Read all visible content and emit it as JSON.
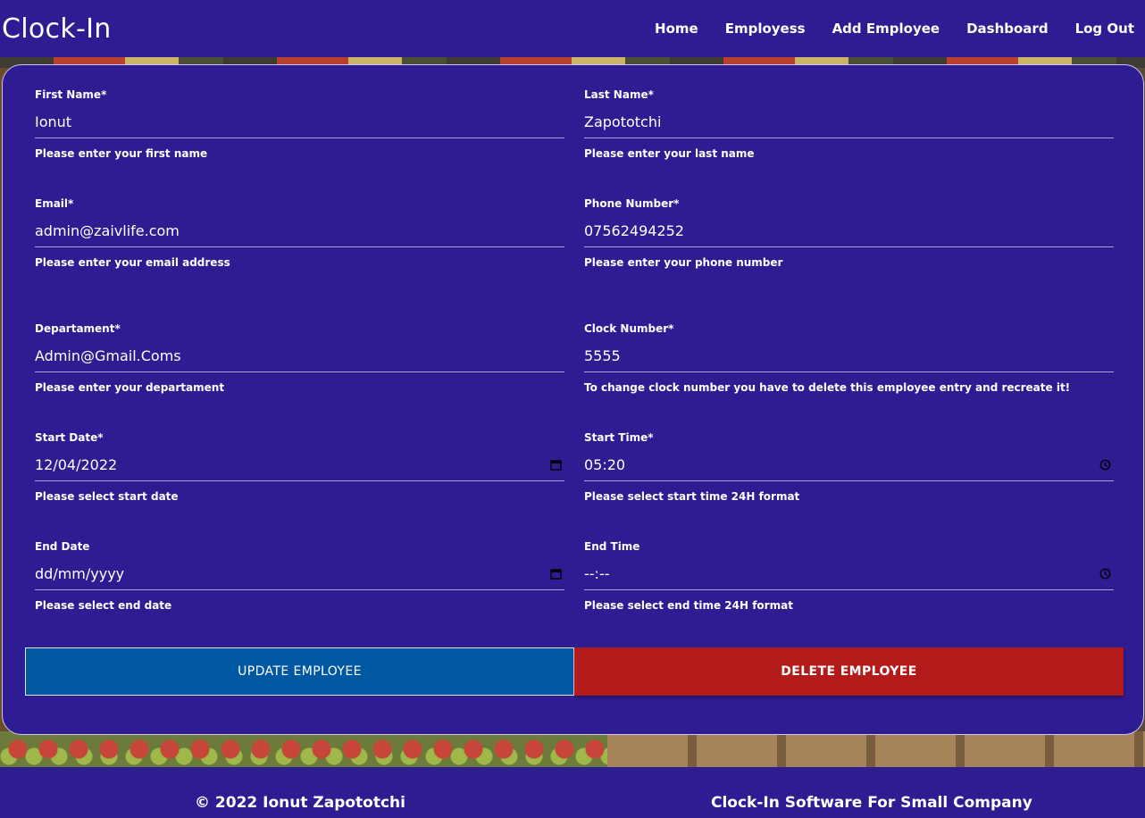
{
  "app": {
    "brand": "Clock-In"
  },
  "nav": {
    "items": [
      {
        "label": "Home"
      },
      {
        "label": "Employess"
      },
      {
        "label": "Add Employee"
      },
      {
        "label": "Dashboard"
      },
      {
        "label": "Log Out"
      }
    ]
  },
  "form": {
    "first_name": {
      "label": "First Name*",
      "value": "Ionut",
      "help": "Please enter your first name"
    },
    "last_name": {
      "label": "Last Name*",
      "value": "Zapototchi",
      "help": "Please enter your last name"
    },
    "email": {
      "label": "Email*",
      "value": "admin@zaivlife.com",
      "help": "Please enter your email address"
    },
    "phone": {
      "label": "Phone Number*",
      "value": "07562494252",
      "help": "Please enter your phone number"
    },
    "department": {
      "label": "Departament*",
      "value": "Admin@Gmail.Coms",
      "help": "Please enter your departament"
    },
    "clock_number": {
      "label": "Clock Number*",
      "value": "5555",
      "help": "To change clock number you have to delete this employee entry and recreate it!"
    },
    "start_date": {
      "label": "Start Date*",
      "value": "12/04/2022",
      "help": "Please select start date",
      "icon": "calendar-icon"
    },
    "start_time": {
      "label": "Start Time*",
      "value": "05:20",
      "help": "Please select start time 24H format",
      "icon": "clock-icon"
    },
    "end_date": {
      "label": "End Date",
      "value": "dd/mm/yyyy",
      "help": "Please select end date",
      "icon": "calendar-icon"
    },
    "end_time": {
      "label": "End Time",
      "value": "--:--",
      "help": "Please select end time 24H format",
      "icon": "clock-icon"
    }
  },
  "actions": {
    "update_label": "UPDATE EMPLOYEE",
    "delete_label": "DELETE EMPLOYEE"
  },
  "footer": {
    "copyright": "© 2022 Ionut Zapototchi",
    "tagline": "Clock-In Software For Small Company"
  },
  "colors": {
    "primary": "#2e1c92",
    "update_button": "#0058a3",
    "delete_button": "#b31b1b"
  }
}
